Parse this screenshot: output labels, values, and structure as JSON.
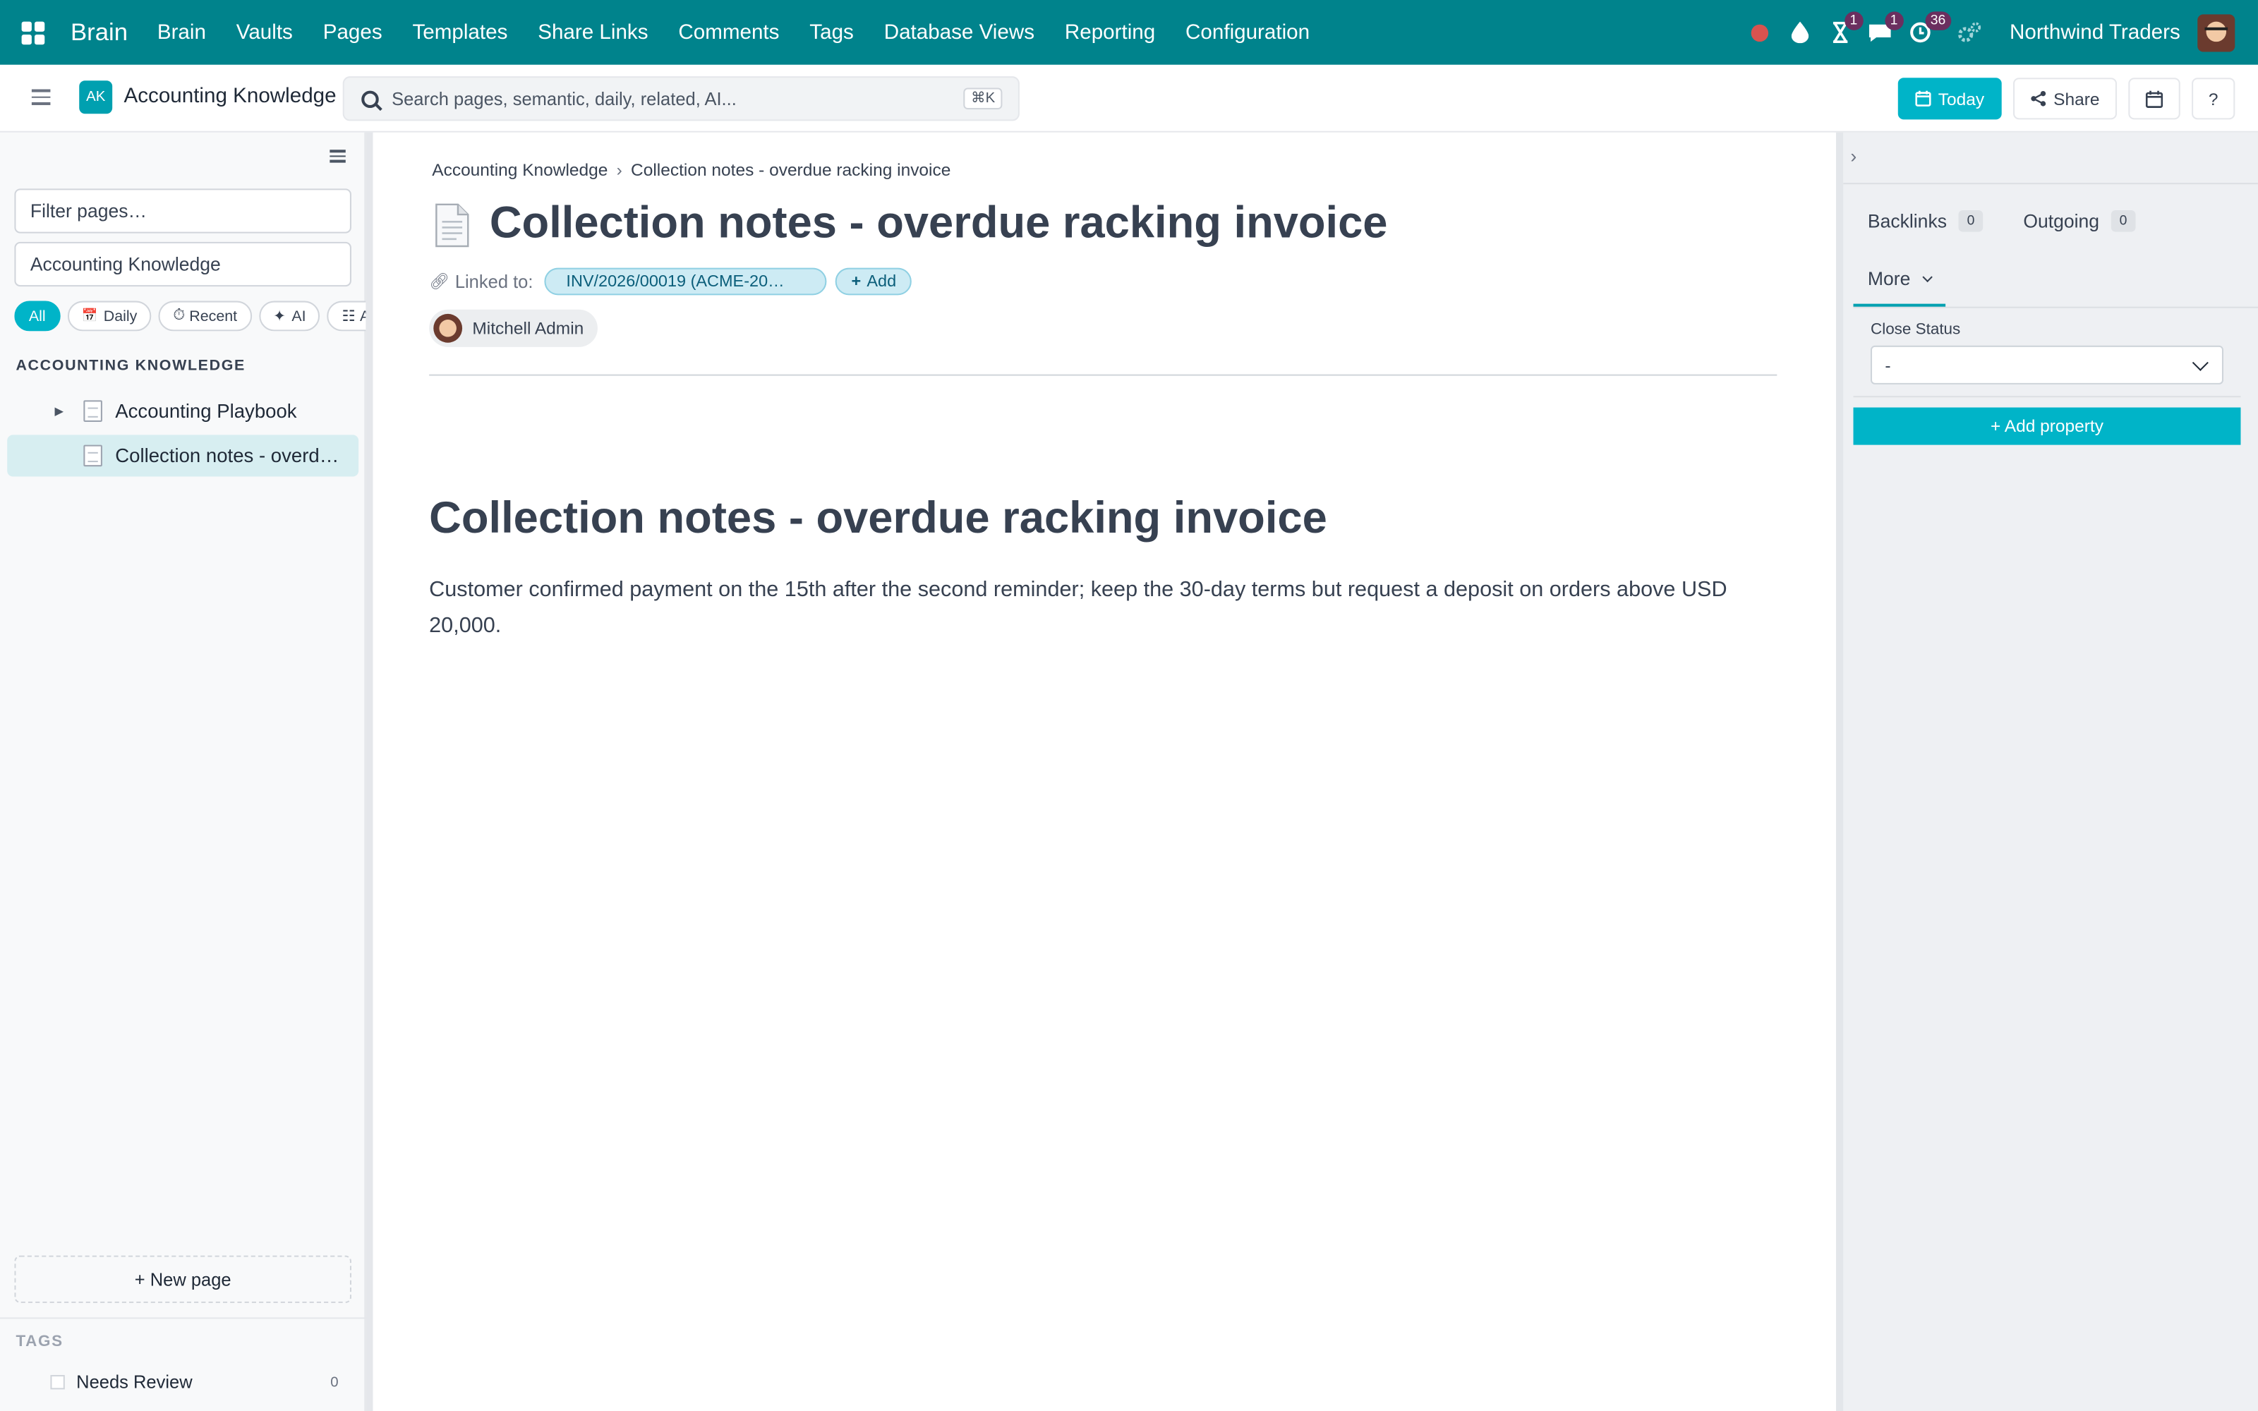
{
  "app": {
    "brand": "Brain",
    "menu": [
      "Brain",
      "Vaults",
      "Pages",
      "Templates",
      "Share Links",
      "Comments",
      "Tags",
      "Database Views",
      "Reporting",
      "Configuration"
    ],
    "badges": {
      "activity": "1",
      "messages": "1",
      "updates": "36"
    },
    "company": "Northwind Traders"
  },
  "header": {
    "vault_initials": "AK",
    "vault_name": "Accounting Knowledge",
    "search_placeholder": "Search pages, semantic, daily, related, AI...",
    "search_shortcut": "⌘K",
    "today_label": "Today",
    "share_label": "Share",
    "help_label": "?"
  },
  "sidebar": {
    "filter_placeholder": "Filter pages…",
    "vault_selected": "Accounting Knowledge",
    "chips": [
      {
        "label": "All",
        "icon": ""
      },
      {
        "label": "Daily",
        "icon": "📅"
      },
      {
        "label": "Recent",
        "icon": "⏱"
      },
      {
        "label": "AI",
        "icon": "✦"
      },
      {
        "label": "A",
        "icon": "☷"
      }
    ],
    "section_title": "ACCOUNTING KNOWLEDGE",
    "tree": [
      {
        "label": "Accounting Playbook",
        "expandable": true
      },
      {
        "label": "Collection notes - overdue racking invoice",
        "expandable": false
      }
    ],
    "new_page_label": "+ New page",
    "tags_title": "TAGS",
    "tags": [
      {
        "label": "Needs Review",
        "count": "0"
      }
    ]
  },
  "page": {
    "breadcrumb": [
      "Accounting Knowledge",
      "Collection notes - overdue racking invoice"
    ],
    "breadcrumb_sep": "›",
    "title": "Collection notes - overdue racking invoice",
    "linked_label": "Linked to:",
    "linked_record": "INV/2026/00019 (ACME-20…",
    "add_link_label": "Add",
    "author": "Mitchell Admin",
    "heading": "Collection notes - overdue racking invoice",
    "body": "Customer confirmed payment on the 15th after the second reminder; keep the 30-day terms but request a deposit on orders above USD 20,000."
  },
  "panel": {
    "backlinks_label": "Backlinks",
    "backlinks_count": "0",
    "outgoing_label": "Outgoing",
    "outgoing_count": "0",
    "more_label": "More",
    "property_label": "Close Status",
    "property_value": "-",
    "add_property_label": "+ Add property"
  },
  "colors": {
    "topbar": "#00838c",
    "accent": "#00b4c8"
  }
}
